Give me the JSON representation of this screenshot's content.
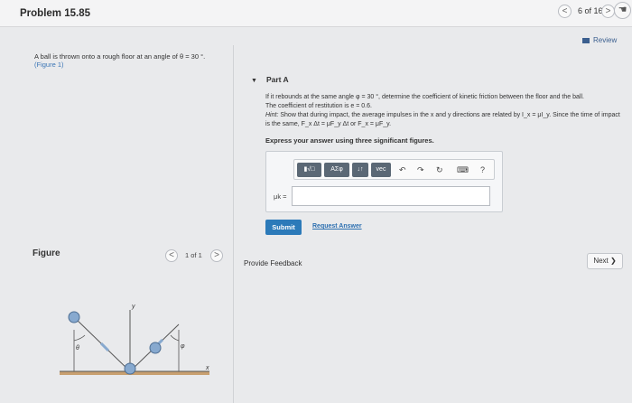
{
  "header": {
    "title": "Problem 15.85",
    "prev_symbol": "<",
    "page_count": "6 of 16",
    "next_symbol": ">",
    "hand_icon": "hand-icon"
  },
  "review": {
    "label": "Review"
  },
  "problem": {
    "statement": "A ball is thrown onto a rough floor at an angle of θ = 30 °.",
    "figure_link": "(Figure 1)"
  },
  "figure": {
    "heading": "Figure",
    "page_count": "1 of 1",
    "prev_symbol": "<",
    "next_symbol": ">",
    "y_label": "y",
    "x_label": "x",
    "theta_label": "θ",
    "phi_label": "φ",
    "colors": {
      "ball": "#87a9cf",
      "floor": "#c8a070",
      "line": "#555555"
    }
  },
  "part_a": {
    "title": "Part A",
    "question_line1": "If it rebounds at the same angle φ = 30 °, determine the coefficient of kinetic friction between the floor and the ball.",
    "question_line2": "The coefficient of restitution is e = 0.6.",
    "hint_label": "Hint:",
    "hint_text": "Show that during impact, the average impulses in the x and y directions are related by I_x = μI_y. Since the time of impact is the same, F_x Δt = μF_y Δt or F_x = μF_y.",
    "instruction": "Express your answer using three significant figures.",
    "toolbar": {
      "template_label": "▮√□",
      "greek_label": "AΣφ",
      "arrows_label": "↓↑",
      "vec_label": "vec",
      "undo_symbol": "↶",
      "redo_symbol": "↷",
      "reset_symbol": "↻",
      "keyboard_symbol": "⌨",
      "help_symbol": "?"
    },
    "answer_label": "μk =",
    "answer_value": "",
    "submit_label": "Submit",
    "request_answer_label": "Request Answer"
  },
  "footer": {
    "feedback_label": "Provide Feedback",
    "next_label": "Next ❯"
  }
}
